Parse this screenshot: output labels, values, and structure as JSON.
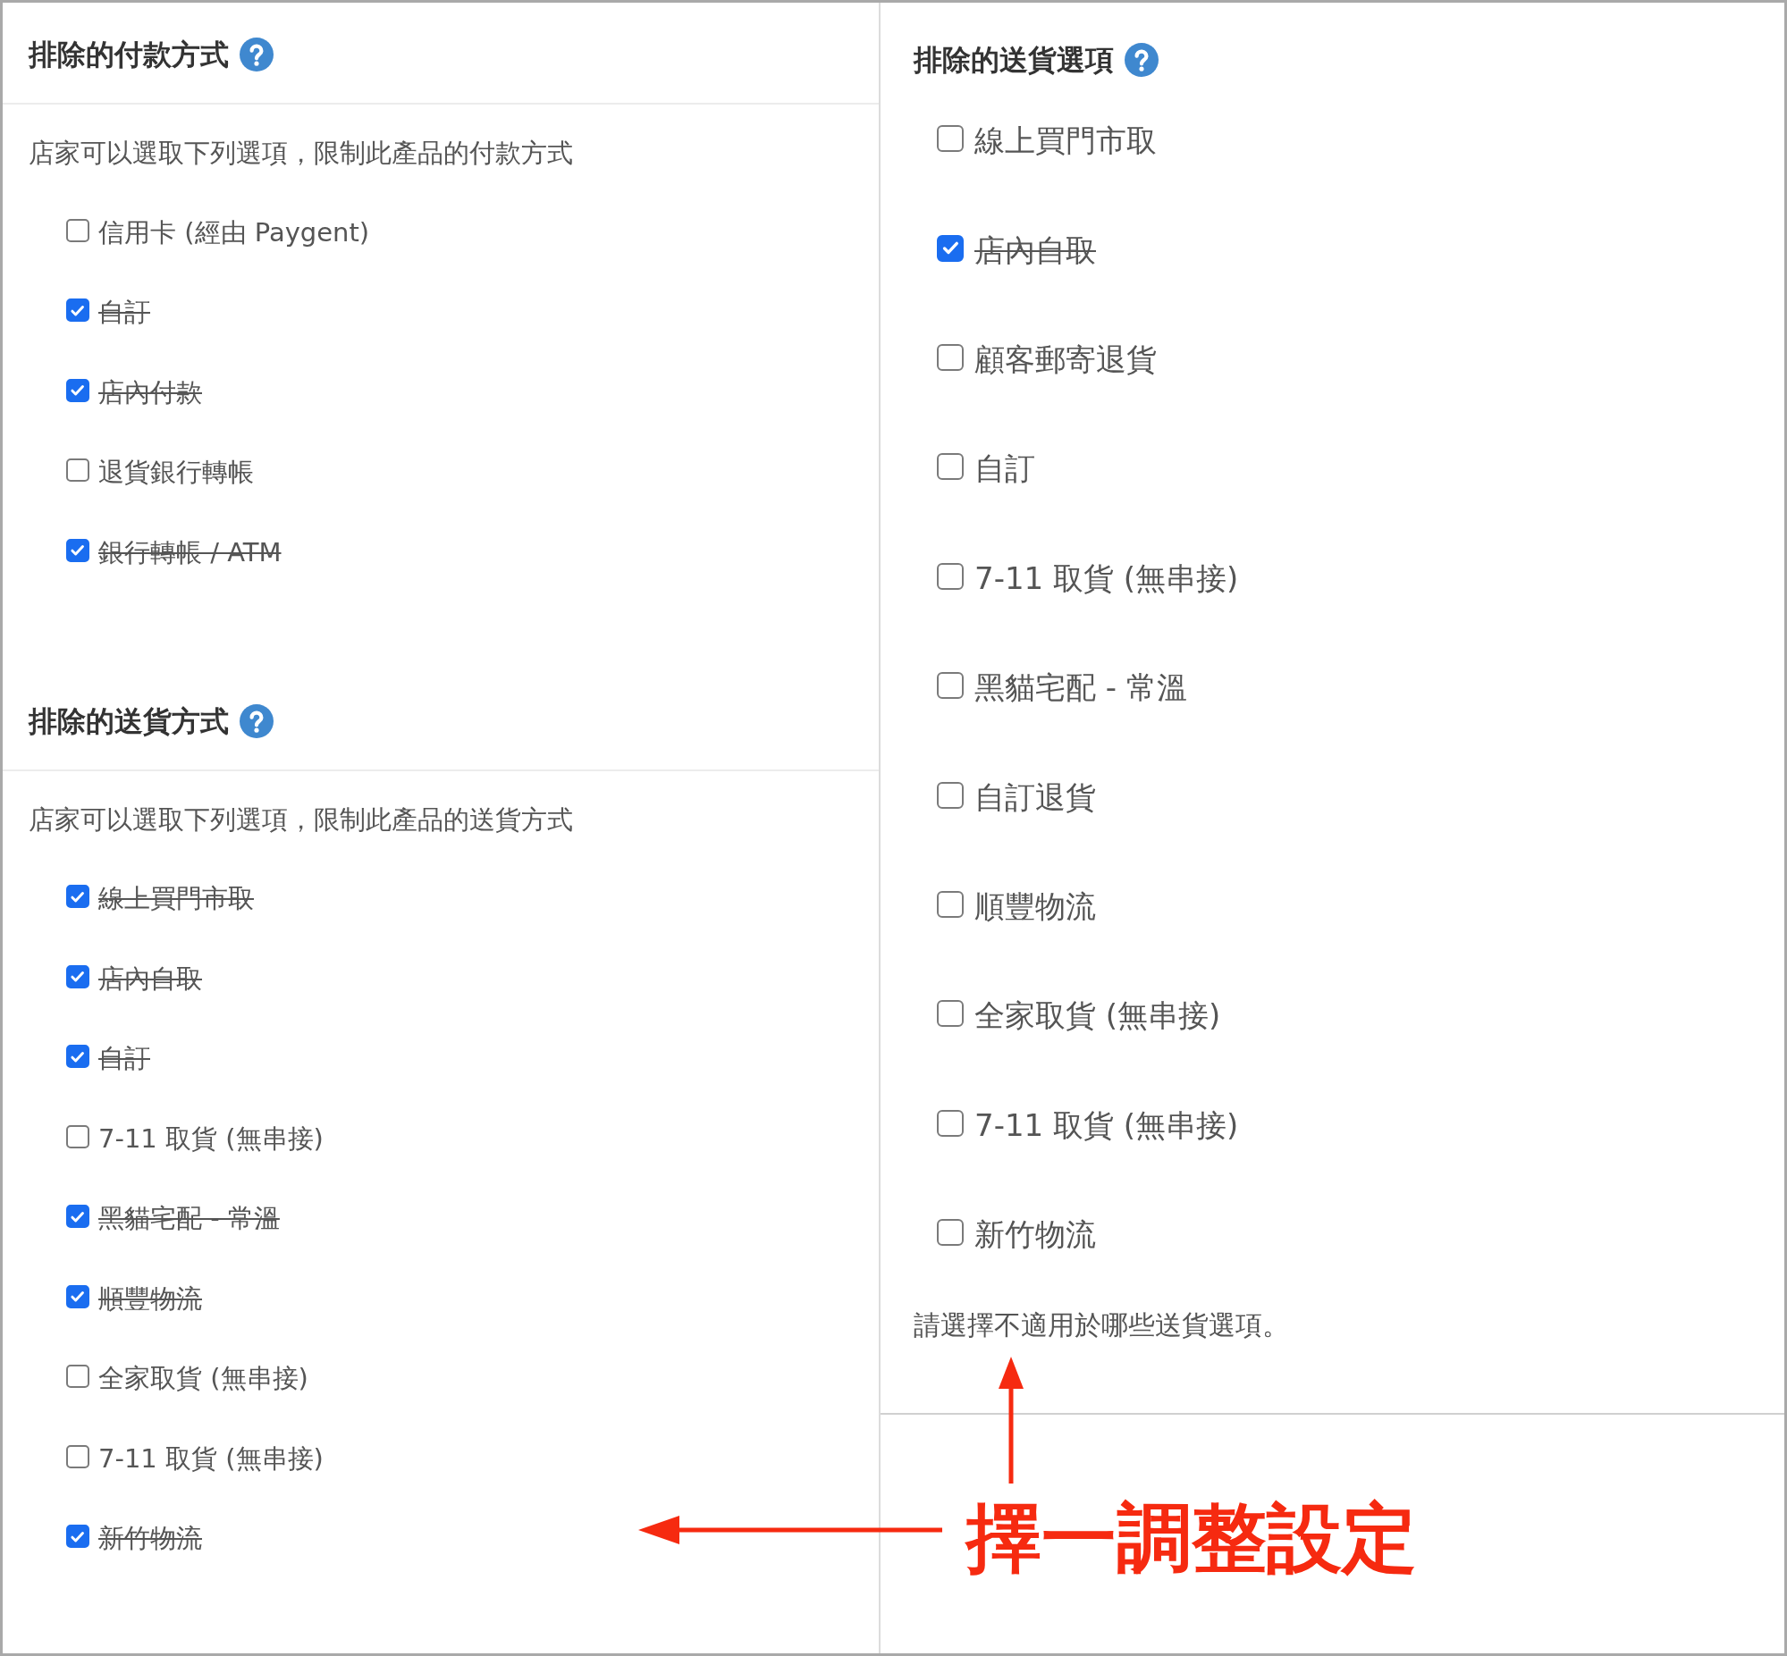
{
  "sections": [
    {
      "title": "排除的付款方式",
      "description": "店家可以選取下列選項，限制此產品的付款方式",
      "options": [
        {
          "label": "信用卡 (經由 Paygent)",
          "checked": false
        },
        {
          "label": "自訂",
          "checked": true
        },
        {
          "label": "店內付款",
          "checked": true
        },
        {
          "label": "退貨銀行轉帳",
          "checked": false
        },
        {
          "label": "銀行轉帳 / ATM",
          "checked": true
        }
      ]
    },
    {
      "title": "排除的送貨方式",
      "description": "店家可以選取下列選項，限制此產品的送貨方式",
      "options": [
        {
          "label": "線上買門市取",
          "checked": true
        },
        {
          "label": "店內自取",
          "checked": true
        },
        {
          "label": "自訂",
          "checked": true
        },
        {
          "label": "7-11 取貨 (無串接)",
          "checked": false
        },
        {
          "label": "黑貓宅配 - 常溫",
          "checked": true
        },
        {
          "label": "順豐物流",
          "checked": true
        },
        {
          "label": "全家取貨 (無串接)",
          "checked": false
        },
        {
          "label": "7-11 取貨 (無串接)",
          "checked": false
        },
        {
          "label": "新竹物流",
          "checked": true
        }
      ]
    }
  ],
  "shipping_options": {
    "title": "排除的送貨選項",
    "options": [
      {
        "label": "線上買門市取",
        "checked": false
      },
      {
        "label": "店內自取",
        "checked": true
      },
      {
        "label": "顧客郵寄退貨",
        "checked": false
      },
      {
        "label": "自訂",
        "checked": false
      },
      {
        "label": "7-11 取貨 (無串接)",
        "checked": false
      },
      {
        "label": "黑貓宅配 - 常溫",
        "checked": false
      },
      {
        "label": "自訂退貨",
        "checked": false
      },
      {
        "label": "順豐物流",
        "checked": false
      },
      {
        "label": "全家取貨 (無串接)",
        "checked": false
      },
      {
        "label": "7-11 取貨 (無串接)",
        "checked": false
      },
      {
        "label": "新竹物流",
        "checked": false
      }
    ],
    "note": "請選擇不適用於哪些送貨選項。"
  },
  "annotation": {
    "text": "擇一調整設定"
  }
}
